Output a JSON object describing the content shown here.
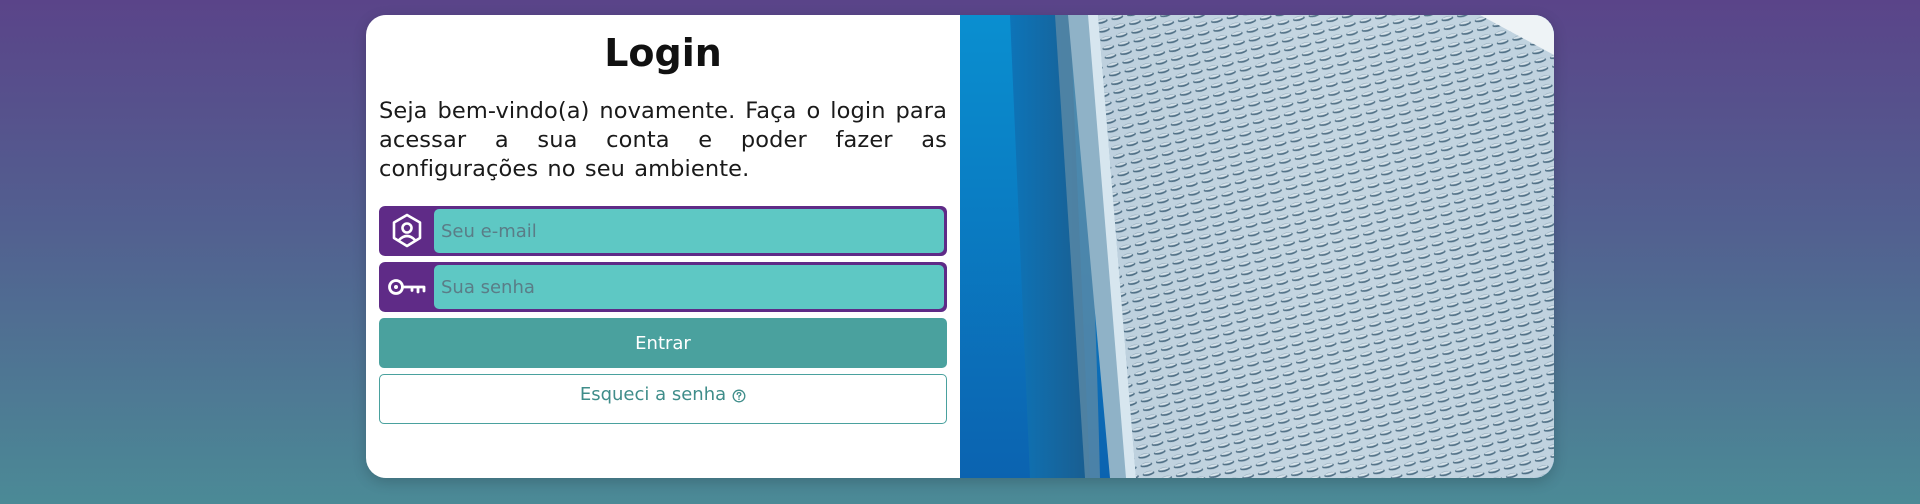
{
  "login": {
    "title": "Login",
    "intro": "Seja bem-vindo(a) novamente. Faça o login para acessar a sua conta e poder fazer as configurações no seu ambiente.",
    "email": {
      "placeholder": "Seu e-mail",
      "value": "",
      "icon": "user-location-icon"
    },
    "password": {
      "placeholder": "Sua senha",
      "value": "",
      "icon": "key-icon"
    },
    "submit_label": "Entrar",
    "forgot_label": "Esqueci a senha",
    "forgot_icon": "help-circle-icon"
  },
  "image": {
    "subject": "building-facade-photo"
  },
  "colors": {
    "accent_purple": "#5f2b87",
    "input_teal": "#5ec8c4",
    "button_teal": "#4aa19e",
    "bg_top": "#5a4489",
    "bg_bottom": "#4b8a96"
  }
}
